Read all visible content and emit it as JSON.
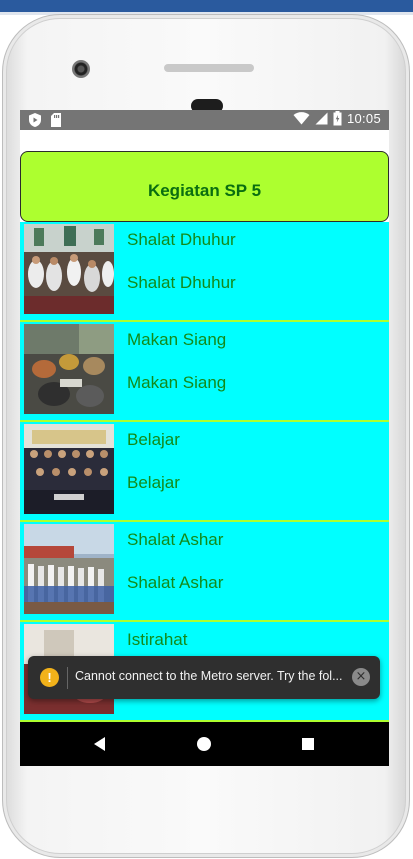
{
  "status_bar": {
    "time": "10:05",
    "icons": [
      "play-protect-icon",
      "sd-card-icon",
      "wifi-icon",
      "signal-icon",
      "battery-icon"
    ]
  },
  "header": {
    "title": "Kegiatan SP 5"
  },
  "activities": [
    {
      "title": "Shalat Dhuhur",
      "subtitle": "Shalat Dhuhur",
      "image": "prayer-hall-photo"
    },
    {
      "title": "Makan Siang",
      "subtitle": "Makan Siang",
      "image": "lunch-photo"
    },
    {
      "title": "Belajar",
      "subtitle": "Belajar",
      "image": "class-group-photo"
    },
    {
      "title": "Shalat Ashar",
      "subtitle": "Shalat Ashar",
      "image": "outdoor-prayer-photo"
    },
    {
      "title": "Istirahat",
      "subtitle": "",
      "image": "rest-photo"
    }
  ],
  "toast": {
    "message": "Cannot connect to the Metro server.  Try the fol...",
    "icon": "warning-icon",
    "close_icon": "close-icon"
  },
  "nav_bar": {
    "buttons": [
      "back-icon",
      "home-icon",
      "recents-icon"
    ]
  },
  "colors": {
    "header_bg": "#adff2f",
    "row_bg": "#00ffff",
    "row_text": "#138a1a",
    "header_text": "#0a6e10",
    "toast_bg": "#2f2f2f"
  }
}
